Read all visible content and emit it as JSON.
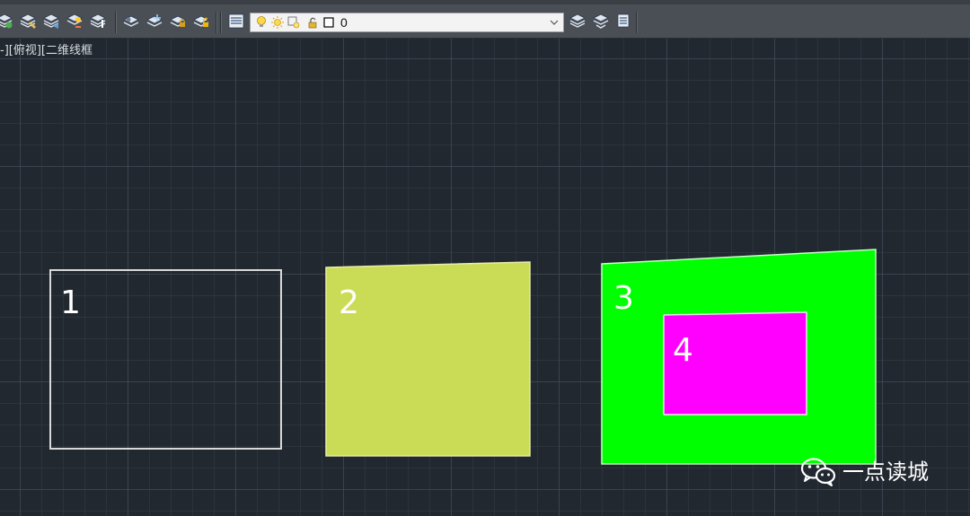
{
  "toolbar": {
    "left_group": [
      {
        "icon": "layer-make-current-icon"
      },
      {
        "icon": "layer-match-icon"
      },
      {
        "icon": "layer-previous-icon"
      },
      {
        "icon": "layer-isolate-icon"
      },
      {
        "icon": "layer-unisolate-icon"
      }
    ],
    "middle_group": [
      {
        "icon": "layer-off-icon"
      },
      {
        "icon": "layer-freeze-icon"
      },
      {
        "icon": "layer-lock-icon"
      },
      {
        "icon": "layer-unlock-icon"
      }
    ],
    "layer_manager_icon": "layer-properties-icon",
    "layer_combo": {
      "glyphs": [
        "lightbulb-on-icon",
        "sun-thaw-icon",
        "viewport-freeze-icon",
        "padlock-unlocked-icon",
        "color-swatch-icon"
      ],
      "layer_name": "0",
      "swatch_color": "#ffffff"
    },
    "right_group": [
      {
        "icon": "layer-states-icon"
      },
      {
        "icon": "layer-walk-icon"
      },
      {
        "icon": "layer-merge-icon"
      }
    ]
  },
  "viewport": {
    "label": "-][俯视][二维线框"
  },
  "drawing": {
    "shapes": [
      {
        "number": "1",
        "kind": "rectangle-outline",
        "stroke": "#d9d9d9",
        "fill": "none"
      },
      {
        "number": "2",
        "kind": "filled-quad",
        "fill": "#cadc55",
        "stroke": "#e6eda8"
      },
      {
        "number": "3",
        "kind": "filled-quad",
        "fill": "#00ff00",
        "stroke": "#c8ffc8"
      },
      {
        "number": "4",
        "kind": "filled-rectangle",
        "fill": "#ff00ff",
        "stroke": "#e8e8e8"
      }
    ]
  },
  "watermark": {
    "icon": "wechat-icon",
    "text": "一点读城"
  },
  "colors": {
    "background": "#212830",
    "toolbar": "#4a4f56"
  }
}
